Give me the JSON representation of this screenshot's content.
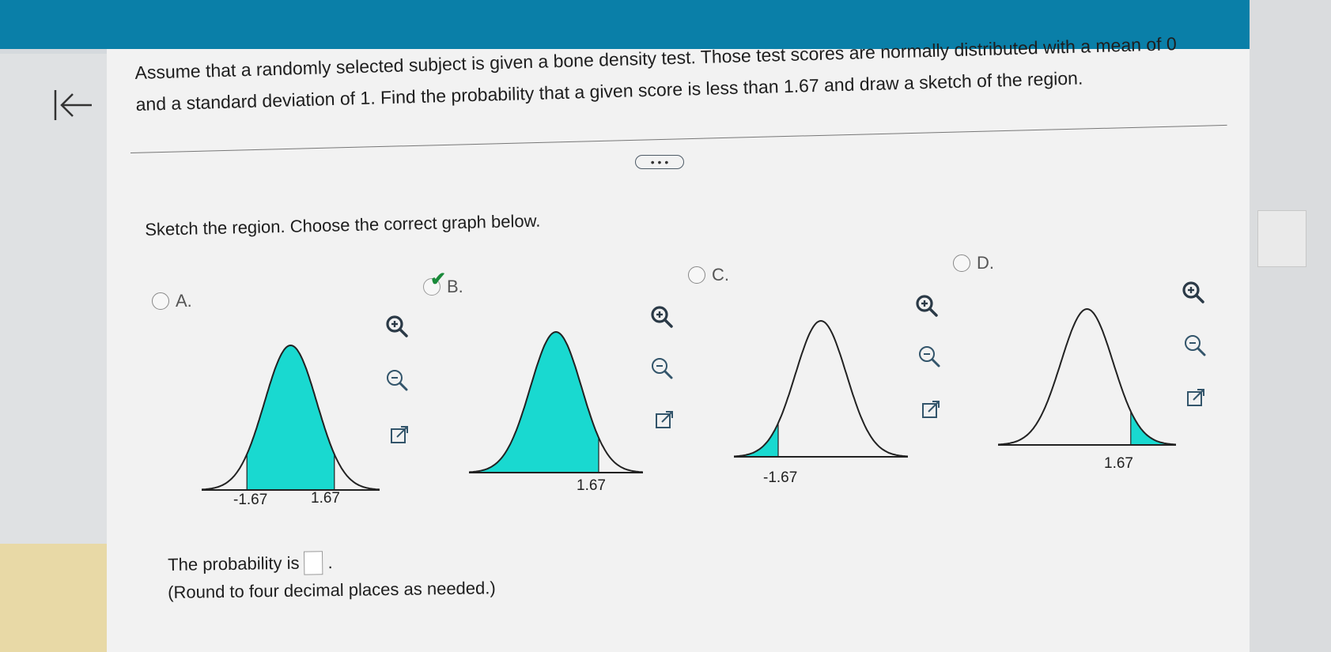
{
  "question": {
    "text": "Assume that a randomly selected subject is given a bone density test. Those test scores are normally distributed with a mean of 0 and a standard deviation of 1. Find the probability that a given score is less than 1.67 and draw a sketch of the region."
  },
  "toolbar": {
    "more_label": "• • •"
  },
  "sketch": {
    "prompt": "Sketch the region. Choose the correct graph below.",
    "options": [
      {
        "label": "A.",
        "selected": false,
        "shading": "between",
        "ticks": [
          "-1.67",
          "1.67"
        ]
      },
      {
        "label": "B.",
        "selected": true,
        "shading": "left",
        "ticks": [
          "1.67"
        ]
      },
      {
        "label": "C.",
        "selected": false,
        "shading": "left",
        "ticks": [
          "-1.67"
        ]
      },
      {
        "label": "D.",
        "selected": false,
        "shading": "right",
        "ticks": [
          "1.67"
        ]
      }
    ]
  },
  "answer": {
    "prefix": "The probability is",
    "suffix": ".",
    "value": "",
    "round_note": "(Round to four decimal places as needed.)"
  },
  "colors": {
    "shade": "#19d9d0",
    "header": "#0a7fa8",
    "check": "#1a8a3a"
  },
  "icons": [
    "back-arrow-icon",
    "zoom-in-icon",
    "zoom-out-icon",
    "external-link-icon",
    "checkmark-icon"
  ]
}
